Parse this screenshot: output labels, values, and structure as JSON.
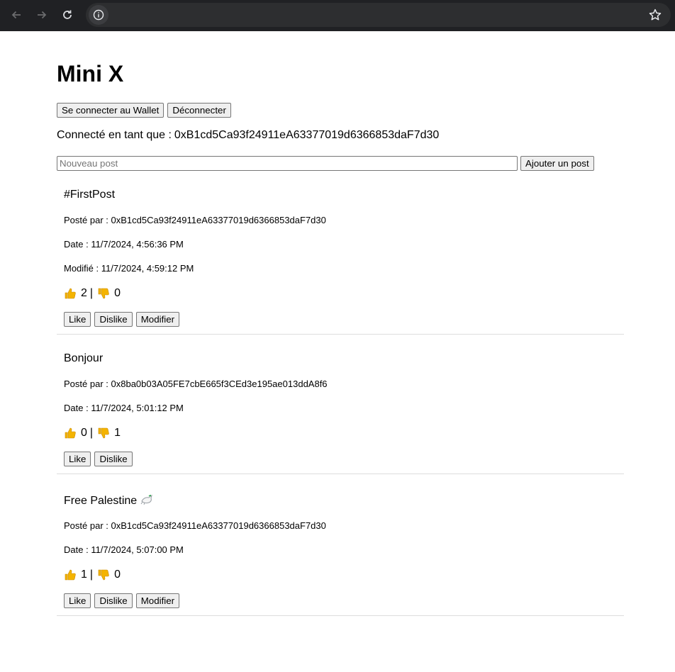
{
  "browser": {
    "url": ""
  },
  "app": {
    "title": "Mini X",
    "connect_wallet_label": "Se connecter au Wallet",
    "disconnect_label": "Déconnecter",
    "connected_label": "Connecté en tant que :",
    "connected_address": "0xB1cd5Ca93f24911eA63377019d6366853daF7d30",
    "new_post_placeholder": "Nouveau post",
    "new_post_value": "",
    "add_post_label": "Ajouter un post"
  },
  "labels": {
    "posted_by": "Posté par :",
    "date": "Date :",
    "modified": "Modifié :",
    "like": "Like",
    "dislike": "Dislike",
    "edit": "Modifier",
    "separator": "|"
  },
  "posts": [
    {
      "content": "#FirstPost",
      "author": "0xB1cd5Ca93f24911eA63377019d6366853daF7d30",
      "date": "11/7/2024, 4:56:36 PM",
      "modified": "11/7/2024, 4:59:12 PM",
      "likes": "2",
      "dislikes": "0",
      "editable": true
    },
    {
      "content": "Bonjour",
      "author": "0x8ba0b03A05FE7cbE665f3CEd3e195ae013ddA8f6",
      "date": "11/7/2024, 5:01:12 PM",
      "likes": "0",
      "dislikes": "1",
      "editable": false
    },
    {
      "content": "Free Palestine",
      "content_icon": "dove-icon",
      "author": "0xB1cd5Ca93f24911eA63377019d6366853daF7d30",
      "date": "11/7/2024, 5:07:00 PM",
      "likes": "1",
      "dislikes": "0",
      "editable": true
    }
  ],
  "icons": {
    "back": "arrow-left-icon",
    "forward": "arrow-right-icon",
    "reload": "reload-icon",
    "site_info": "info-icon",
    "bookmark": "star-icon",
    "like": "thumbs-up-icon",
    "dislike": "thumbs-down-icon"
  },
  "colors": {
    "chrome_bg": "#202124",
    "omnibox_bg": "#2d2e30",
    "emoji_yellow": "#f4b400",
    "divider": "#dddddd"
  }
}
